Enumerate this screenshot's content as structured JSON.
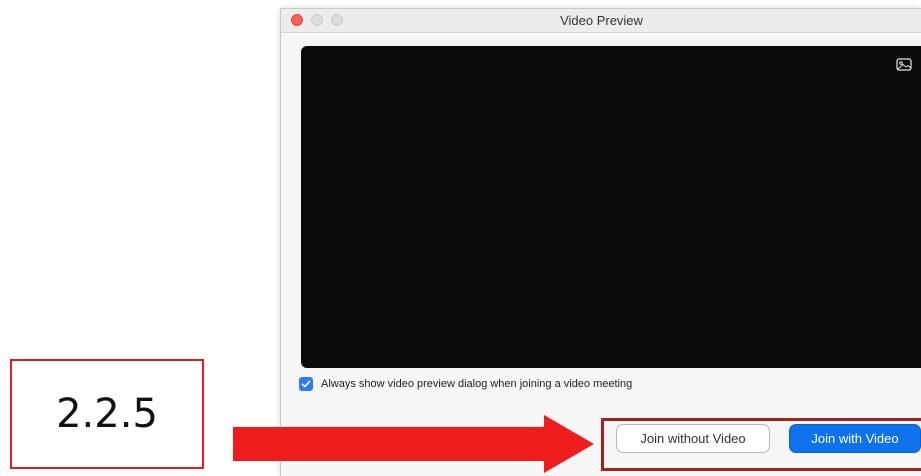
{
  "window": {
    "title": "Video Preview"
  },
  "preview": {
    "background_color": "#0a0c0a",
    "overlay_icon": "photo-icon"
  },
  "options": {
    "always_show_preview_label": "Always show video preview dialog when joining a video meeting",
    "always_show_preview_checked": true
  },
  "buttons": {
    "join_without_video": "Join without Video",
    "join_with_video": "Join with Video"
  },
  "annotation": {
    "step_label": "2.2.5",
    "arrow_color": "#ee1c1c",
    "highlight_color": "#a32121"
  },
  "colors": {
    "primary": "#0e72ed",
    "close": "#ff5f57"
  }
}
